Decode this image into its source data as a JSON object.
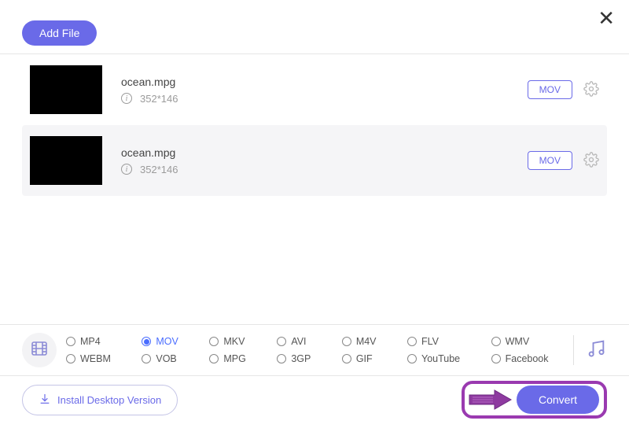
{
  "header": {
    "add_file_label": "Add File"
  },
  "files": [
    {
      "name": "ocean.mpg",
      "dimensions": "352*146",
      "target_format": "MOV",
      "highlighted": false
    },
    {
      "name": "ocean.mpg",
      "dimensions": "352*146",
      "target_format": "MOV",
      "highlighted": true
    }
  ],
  "format_options_row1": [
    {
      "label": "MP4",
      "selected": false
    },
    {
      "label": "MOV",
      "selected": true
    },
    {
      "label": "MKV",
      "selected": false
    },
    {
      "label": "AVI",
      "selected": false
    },
    {
      "label": "M4V",
      "selected": false
    },
    {
      "label": "FLV",
      "selected": false
    },
    {
      "label": "WMV",
      "selected": false
    }
  ],
  "format_options_row2": [
    {
      "label": "WEBM",
      "selected": false
    },
    {
      "label": "VOB",
      "selected": false
    },
    {
      "label": "MPG",
      "selected": false
    },
    {
      "label": "3GP",
      "selected": false
    },
    {
      "label": "GIF",
      "selected": false
    },
    {
      "label": "YouTube",
      "selected": false
    },
    {
      "label": "Facebook",
      "selected": false
    }
  ],
  "footer": {
    "install_label": "Install Desktop Version",
    "convert_label": "Convert"
  }
}
